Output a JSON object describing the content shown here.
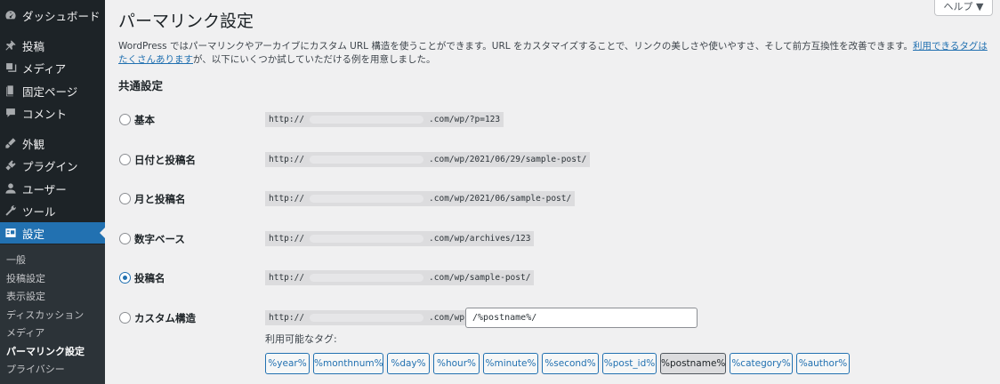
{
  "sidebar": {
    "items": [
      {
        "label": "ダッシュボード",
        "icon": "dashboard-icon"
      },
      {
        "label": "投稿",
        "icon": "pin-icon"
      },
      {
        "label": "メディア",
        "icon": "media-icon"
      },
      {
        "label": "固定ページ",
        "icon": "pages-icon"
      },
      {
        "label": "コメント",
        "icon": "comment-icon"
      },
      {
        "label": "外観",
        "icon": "appearance-icon"
      },
      {
        "label": "プラグイン",
        "icon": "plugin-icon"
      },
      {
        "label": "ユーザー",
        "icon": "user-icon"
      },
      {
        "label": "ツール",
        "icon": "tool-icon"
      },
      {
        "label": "設定",
        "icon": "settings-icon"
      }
    ],
    "submenu": [
      "一般",
      "投稿設定",
      "表示設定",
      "ディスカッション",
      "メディア",
      "パーマリンク設定",
      "プライバシー"
    ]
  },
  "header": {
    "help_label": "ヘルプ ▼"
  },
  "page": {
    "title": "パーマリンク設定",
    "intro_text": "WordPress ではパーマリンクやアーカイブにカスタム URL 構造を使うことができます。URL をカスタマイズすることで、リンクの美しさや使いやすさ、そして前方互換性を改善できます。",
    "intro_link": "利用できるタグはたくさんあります",
    "intro_text2": "が、以下にいくつか試していただける例を用意しました。",
    "section_title": "共通設定"
  },
  "options": [
    {
      "label": "基本",
      "prefix": "http://",
      "suffix": ".com/wp/?p=123",
      "checked": false
    },
    {
      "label": "日付と投稿名",
      "prefix": "http://",
      "suffix": ".com/wp/2021/06/29/sample-post/",
      "checked": false
    },
    {
      "label": "月と投稿名",
      "prefix": "http://",
      "suffix": ".com/wp/2021/06/sample-post/",
      "checked": false
    },
    {
      "label": "数字ベース",
      "prefix": "http://",
      "suffix": ".com/wp/archives/123",
      "checked": false
    },
    {
      "label": "投稿名",
      "prefix": "http://",
      "suffix": ".com/wp/sample-post/",
      "checked": true
    },
    {
      "label": "カスタム構造",
      "prefix": "http://",
      "suffix": ".com/wp",
      "checked": false
    }
  ],
  "custom": {
    "value": "/%postname%/",
    "tags_label": "利用可能なタグ:",
    "tags": [
      "%year%",
      "%monthnum%",
      "%day%",
      "%hour%",
      "%minute%",
      "%second%",
      "%post_id%",
      "%postname%",
      "%category%",
      "%author%"
    ],
    "active_tag": "%postname%"
  },
  "colors": {
    "accent": "#2271b1",
    "sidebar_bg": "#1d2327",
    "submenu_bg": "#2c3338",
    "page_bg": "#f0f0f1"
  }
}
